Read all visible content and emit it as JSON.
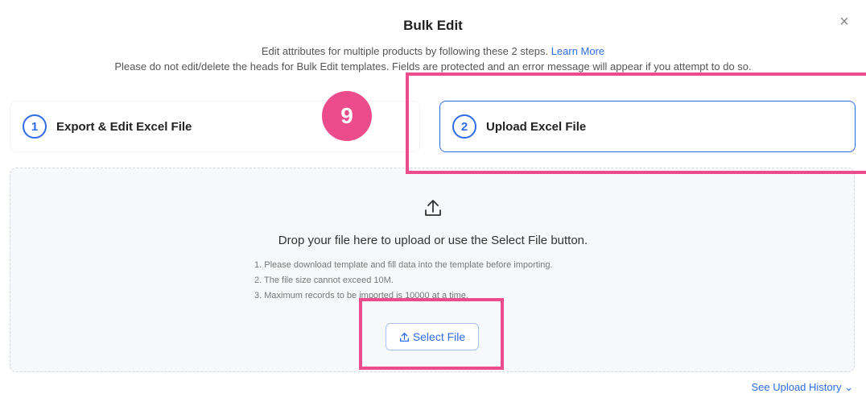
{
  "dialog": {
    "title": "Bulk Edit",
    "close_symbol": "×",
    "description_line1": "Edit attributes for multiple products by following these 2 steps.",
    "learn_more": "Learn More",
    "description_line2": "Please do not edit/delete the heads for Bulk Edit templates. Fields are protected and an error message will appear if you attempt to do so."
  },
  "steps": [
    {
      "number": "1",
      "label": "Export & Edit Excel File"
    },
    {
      "number": "2",
      "label": "Upload Excel File"
    }
  ],
  "annotation_badge": "9",
  "dropzone": {
    "icon": "upload-icon",
    "main_text": "Drop your file here to upload or use the Select File button.",
    "notes": [
      "1. Please download template and fill data into the template before importing.",
      "2. The file size cannot exceed 10M.",
      "3. Maximum records to be imported is 10000 at a time."
    ],
    "select_button": "Select File"
  },
  "footer": {
    "history_link": "See Upload History"
  },
  "colors": {
    "accent": "#2f6ce5",
    "highlight": "#ec4c8b"
  }
}
